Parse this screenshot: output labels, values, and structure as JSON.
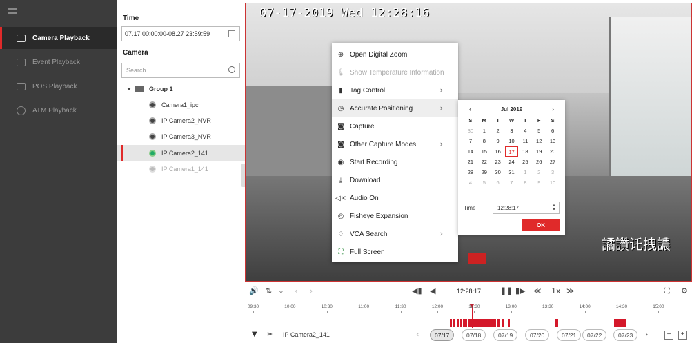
{
  "nav": {
    "items": [
      {
        "label": "Camera Playback",
        "icon": "camera-playback-icon",
        "active": true
      },
      {
        "label": "Event Playback",
        "icon": "event-playback-icon",
        "active": false
      },
      {
        "label": "POS Playback",
        "icon": "pos-playback-icon",
        "active": false
      },
      {
        "label": "ATM Playback",
        "icon": "atm-playback-icon",
        "active": false
      }
    ]
  },
  "panel": {
    "time_label": "Time",
    "time_range": "07.17 00:00:00-08.27 23:59:59",
    "camera_label": "Camera",
    "search_placeholder": "Search",
    "group": "Group 1",
    "cameras": [
      {
        "name": "Camera1_ipc",
        "status": "online"
      },
      {
        "name": "IP Camera2_NVR",
        "status": "online"
      },
      {
        "name": "IP Camera3_NVR",
        "status": "online"
      },
      {
        "name": "IP Camera2_141",
        "status": "selected"
      },
      {
        "name": "IP Camera1_141",
        "status": "offline"
      }
    ]
  },
  "video": {
    "timestamp": "07-17-2019 Wed 12:28:16",
    "osd_text": "譎讚讬拽譨"
  },
  "context_menu": {
    "items": [
      {
        "label": "Open Digital Zoom",
        "icon": "zoom-in-icon",
        "symbol": "⊕",
        "submenu": false,
        "state": "normal"
      },
      {
        "label": "Show Temperature Information",
        "icon": "thermometer-icon",
        "symbol": "🌡",
        "submenu": false,
        "state": "disabled"
      },
      {
        "label": "Tag Control",
        "icon": "bookmark-icon",
        "symbol": "▮",
        "submenu": true,
        "state": "normal"
      },
      {
        "label": "Accurate Positioning",
        "icon": "clock-icon",
        "symbol": "◷",
        "submenu": true,
        "state": "hover"
      },
      {
        "label": "Capture",
        "icon": "camera-icon",
        "symbol": "◙",
        "submenu": false,
        "state": "normal"
      },
      {
        "label": "Other Capture Modes",
        "icon": "camera-icon",
        "symbol": "◙",
        "submenu": true,
        "state": "normal"
      },
      {
        "label": "Start Recording",
        "icon": "record-icon",
        "symbol": "◉",
        "submenu": false,
        "state": "normal"
      },
      {
        "label": "Download",
        "icon": "download-icon",
        "symbol": "⤓",
        "submenu": false,
        "state": "normal"
      },
      {
        "label": "Audio On",
        "icon": "speaker-muted-icon",
        "symbol": "◁×",
        "submenu": false,
        "state": "normal"
      },
      {
        "label": "Fisheye Expansion",
        "icon": "fisheye-icon",
        "symbol": "◎",
        "submenu": false,
        "state": "normal"
      },
      {
        "label": "VCA Search",
        "icon": "pin-icon",
        "symbol": "♢",
        "submenu": true,
        "state": "normal"
      },
      {
        "label": "Full Screen",
        "icon": "fullscreen-icon",
        "symbol": "⛶",
        "submenu": false,
        "state": "normal"
      }
    ],
    "submenu_arrow": "›"
  },
  "datepicker": {
    "prev": "‹",
    "month_year": "Jul  2019",
    "next": "›",
    "weekdays": [
      "S",
      "M",
      "T",
      "W",
      "T",
      "F",
      "S"
    ],
    "days": [
      [
        "30",
        "1",
        "2",
        "3",
        "4",
        "5",
        "6"
      ],
      [
        "7",
        "8",
        "9",
        "10",
        "11",
        "12",
        "13"
      ],
      [
        "14",
        "15",
        "16",
        "17",
        "18",
        "19",
        "20"
      ],
      [
        "21",
        "22",
        "23",
        "24",
        "25",
        "26",
        "27"
      ],
      [
        "28",
        "29",
        "30",
        "31",
        "1",
        "2",
        "3"
      ],
      [
        "4",
        "5",
        "6",
        "7",
        "8",
        "9",
        "10"
      ]
    ],
    "selected_day": "17",
    "time_label": "Time",
    "time_value": "12:28:17",
    "ok_label": "OK"
  },
  "controls": {
    "volume": "🔊",
    "sync": "⇅",
    "download": "⤓",
    "prev": "‹",
    "next": "›",
    "prev_frame": "◀▮",
    "reverse": "◀",
    "time": "12:28:17",
    "pause": "❚❚",
    "step": "▮▶",
    "slower": "≪",
    "speed": "1x",
    "faster": "≫",
    "expand": "⛶",
    "settings": "⚙"
  },
  "timeline": {
    "ticks": [
      "09:30",
      "10:00",
      "10:30",
      "11:00",
      "11:30",
      "12:00",
      "12:30",
      "13:00",
      "13:30",
      "14:00",
      "14:30",
      "15:00"
    ]
  },
  "bottom": {
    "filter": "▼",
    "clip": "✂",
    "camera_name": "IP Camera2_141",
    "prev": "‹",
    "dates": [
      "07/17",
      "07/18",
      "07/19",
      "07/20",
      "07/21",
      "07/22",
      "07/23"
    ],
    "selected_date": "07/17",
    "next": "›",
    "zoom_out": "−",
    "zoom_in": "+"
  },
  "colors": {
    "accent": "#e02a2a",
    "nav_bg": "#3c3c3c",
    "record": "#d4182a"
  }
}
